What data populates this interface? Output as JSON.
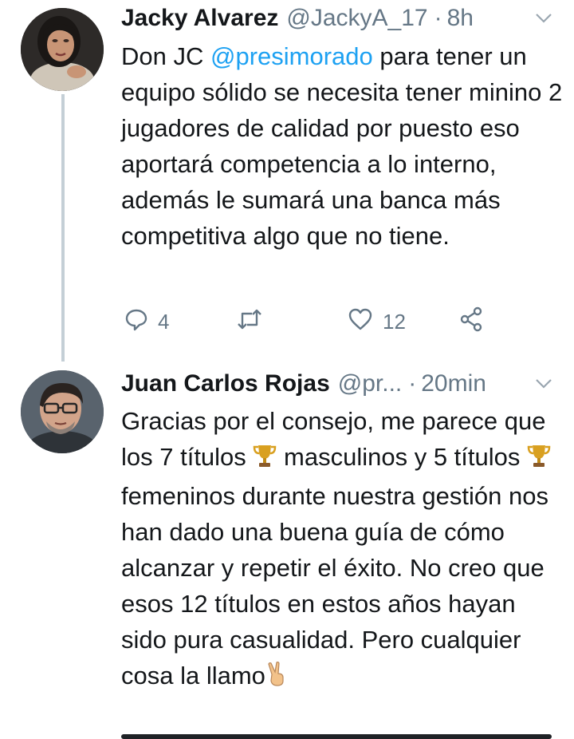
{
  "tweets": [
    {
      "author_name": "Jacky Alvarez",
      "handle": "@JackyA_17",
      "time_separator": "·",
      "time": "8h",
      "text_parts": [
        "Don JC ",
        "@presimorado",
        " para tener un equipo sólido se necesita tener minino 2 jugadores de calidad por puesto eso aportará competencia a lo interno, además le sumará una banca más competitiva algo que no tiene."
      ],
      "actions": {
        "reply_count": "4",
        "retweet_count": "",
        "like_count": "12"
      },
      "avatar_icon": "woman-avatar"
    },
    {
      "author_name": "Juan Carlos Rojas",
      "handle": "@pr...",
      "time_separator": "·",
      "time": "20min",
      "text_parts": [
        "Gracias por el consejo, me parece que los 7 títulos ",
        " masculinos y 5 títulos ",
        " femeninos durante nuestra gestión nos han dado una buena guía de cómo alcanzar y repetir el éxito. No creo que esos 12 títulos en estos años hayan sido pura casualidad. Pero cualquier cosa la llamo"
      ],
      "emojis": [
        "trophy-emoji",
        "victory-hand-emoji"
      ],
      "avatar_icon": "man-with-glasses-avatar"
    }
  ],
  "colors": {
    "link": "#1da1f2",
    "secondary_text": "#657786",
    "thread_line": "#c4cfd6"
  }
}
